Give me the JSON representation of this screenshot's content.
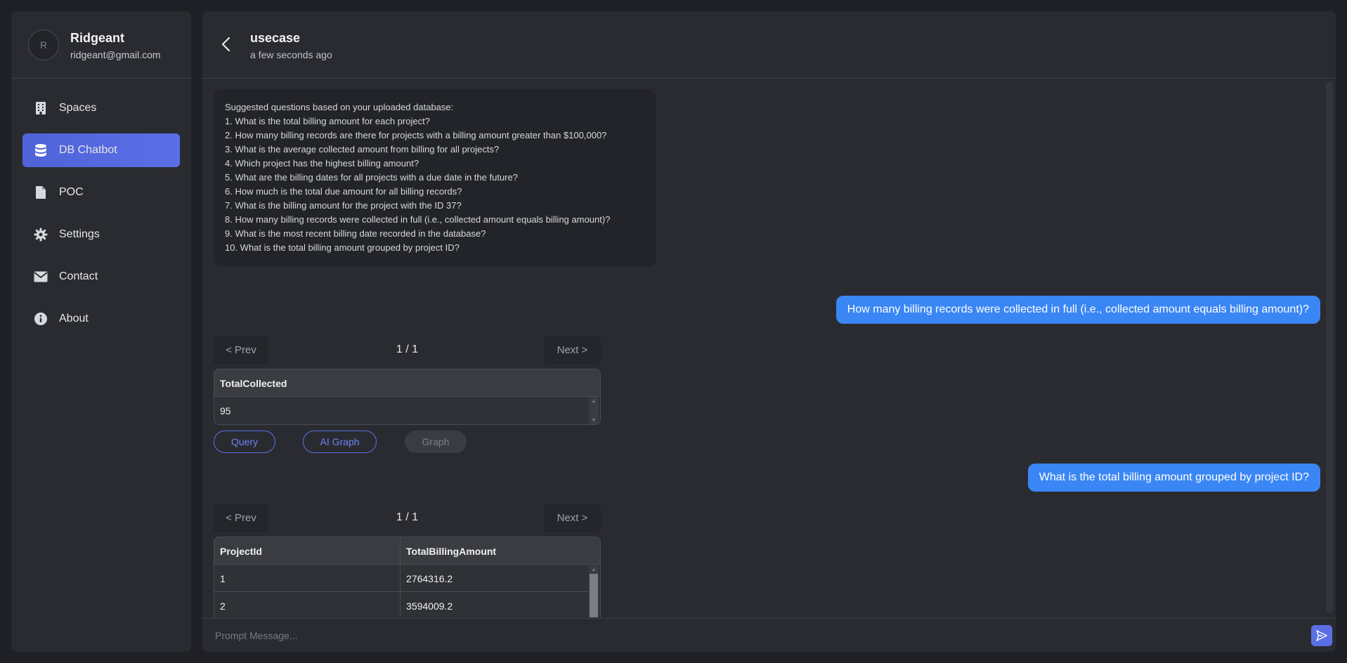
{
  "sidebar": {
    "profile": {
      "initial": "R",
      "name": "Ridgeant",
      "email": "ridgeant@gmail.com"
    },
    "items": [
      {
        "label": "Spaces",
        "icon": "building-icon"
      },
      {
        "label": "DB Chatbot",
        "icon": "database-icon",
        "active": true
      },
      {
        "label": "POC",
        "icon": "file-icon"
      },
      {
        "label": "Settings",
        "icon": "gear-icon"
      },
      {
        "label": "Contact",
        "icon": "envelope-icon"
      },
      {
        "label": "About",
        "icon": "info-icon"
      }
    ]
  },
  "header": {
    "title": "usecase",
    "subtitle": "a few seconds ago"
  },
  "suggestions": {
    "intro": "Suggested questions based on your uploaded database:",
    "items": [
      "1. What is the total billing amount for each project?",
      "2. How many billing records are there for projects with a billing amount greater than $100,000?",
      "3. What is the average collected amount from billing for all projects?",
      "4. Which project has the highest billing amount?",
      "5. What are the billing dates for all projects with a due date in the future?",
      "6. How much is the total due amount for all billing records?",
      "7. What is the billing amount for the project with the ID 37?",
      "8. How many billing records were collected in full (i.e., collected amount equals billing amount)?",
      "9. What is the most recent billing date recorded in the database?",
      "10. What is the total billing amount grouped by project ID?"
    ]
  },
  "messages": [
    {
      "question": "How many billing records were collected in full (i.e., collected amount equals billing amount)?",
      "pager": {
        "prev": "< Prev",
        "page": "1 / 1",
        "next": "Next >"
      },
      "table": {
        "headers": [
          "TotalCollected"
        ],
        "rows": [
          [
            "95"
          ]
        ]
      },
      "actions": {
        "query": "Query",
        "ai_graph": "AI Graph",
        "graph": "Graph"
      }
    },
    {
      "question": "What is the total billing amount grouped by project ID?",
      "pager": {
        "prev": "< Prev",
        "page": "1 / 1",
        "next": "Next >"
      },
      "table": {
        "headers": [
          "ProjectId",
          "TotalBillingAmount"
        ],
        "rows": [
          [
            "1",
            "2764316.2"
          ],
          [
            "2",
            "3594009.2"
          ]
        ]
      }
    }
  ],
  "prompt": {
    "placeholder": "Prompt Message..."
  },
  "colors": {
    "accent": "#5a6fe6",
    "user_bubble": "#3a86f5",
    "panel": "#2a2b31",
    "background": "#1f2025"
  }
}
